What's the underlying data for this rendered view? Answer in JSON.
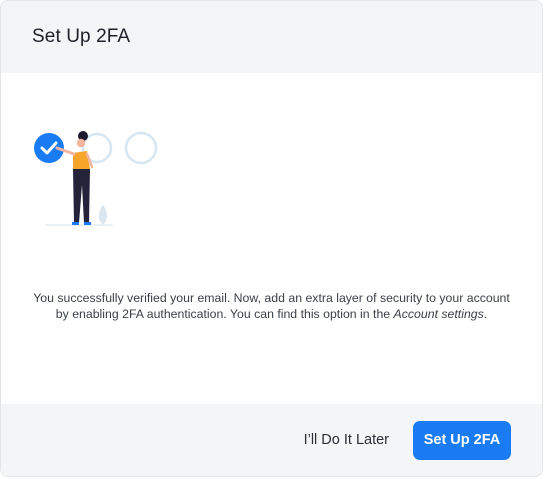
{
  "modal": {
    "title": "Set Up 2FA",
    "message_part1": "You successfully verified your email. Now, add an extra layer of security to your account by enabling 2FA authentication. You can find this option in the ",
    "message_link": "Account settings",
    "message_end": ".",
    "illustration": {
      "steps_total": 3,
      "steps_completed": 1,
      "icons": [
        "check-icon",
        "person-illustration",
        "plant-icon"
      ]
    }
  },
  "footer": {
    "later_label": "I’ll Do It Later",
    "primary_label": "Set Up 2FA"
  },
  "colors": {
    "accent": "#1a7cf5",
    "header_bg": "#f4f5f7",
    "text": "#1d2129",
    "step_ring": "#d6e6f2",
    "shirt": "#f6a52a"
  }
}
